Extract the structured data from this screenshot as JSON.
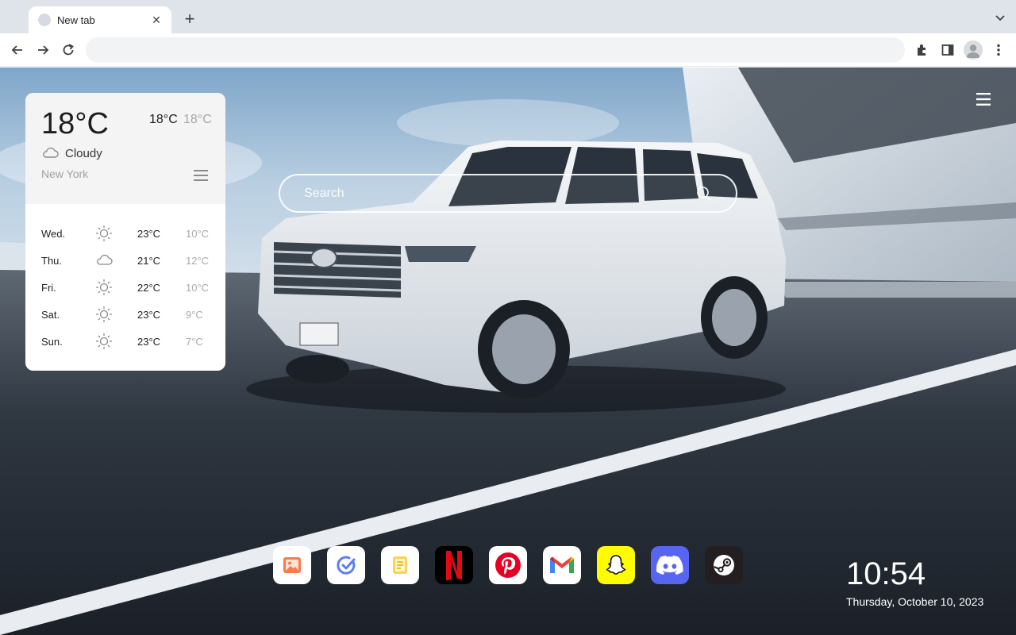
{
  "browser": {
    "tab_title": "New tab",
    "tab_close": "✕",
    "new_tab": "+",
    "omnibox_placeholder": ""
  },
  "weather": {
    "current_temp": "18°C",
    "high": "18°C",
    "low": "18°C",
    "condition": "Cloudy",
    "condition_icon": "cloud-icon",
    "city": "New York",
    "forecast": [
      {
        "day": "Wed.",
        "icon": "sun-icon",
        "high": "23°C",
        "low": "10°C"
      },
      {
        "day": "Thu.",
        "icon": "cloud-icon",
        "high": "21°C",
        "low": "12°C"
      },
      {
        "day": "Fri.",
        "icon": "sun-icon",
        "high": "22°C",
        "low": "10°C"
      },
      {
        "day": "Sat.",
        "icon": "sun-icon",
        "high": "23°C",
        "low": "9°C"
      },
      {
        "day": "Sun.",
        "icon": "sun-icon",
        "high": "23°C",
        "low": "7°C"
      }
    ]
  },
  "search": {
    "placeholder": "Search"
  },
  "dock": [
    {
      "app": "gallery",
      "icon": "image-icon",
      "bg": "#ffffff"
    },
    {
      "app": "tasks",
      "icon": "check-circle-icon",
      "bg": "#ffffff"
    },
    {
      "app": "notes",
      "icon": "note-icon",
      "bg": "#ffffff"
    },
    {
      "app": "netflix",
      "icon": "netflix-icon",
      "bg": "#000000"
    },
    {
      "app": "pinterest",
      "icon": "pinterest-icon",
      "bg": "#ffffff"
    },
    {
      "app": "gmail",
      "icon": "gmail-icon",
      "bg": "#ffffff"
    },
    {
      "app": "snapchat",
      "icon": "snapchat-icon",
      "bg": "#fffc00"
    },
    {
      "app": "discord",
      "icon": "discord-icon",
      "bg": "#5865f2"
    },
    {
      "app": "steam",
      "icon": "steam-icon",
      "bg": "#231f20"
    }
  ],
  "clock": {
    "time": "10:54",
    "date": "Thursday, October 10, 2023"
  },
  "colors": {
    "netflix_red": "#e50914",
    "pinterest_red": "#e60023",
    "discord_blurple": "#5865f2",
    "snapchat_yellow": "#fffc00"
  }
}
